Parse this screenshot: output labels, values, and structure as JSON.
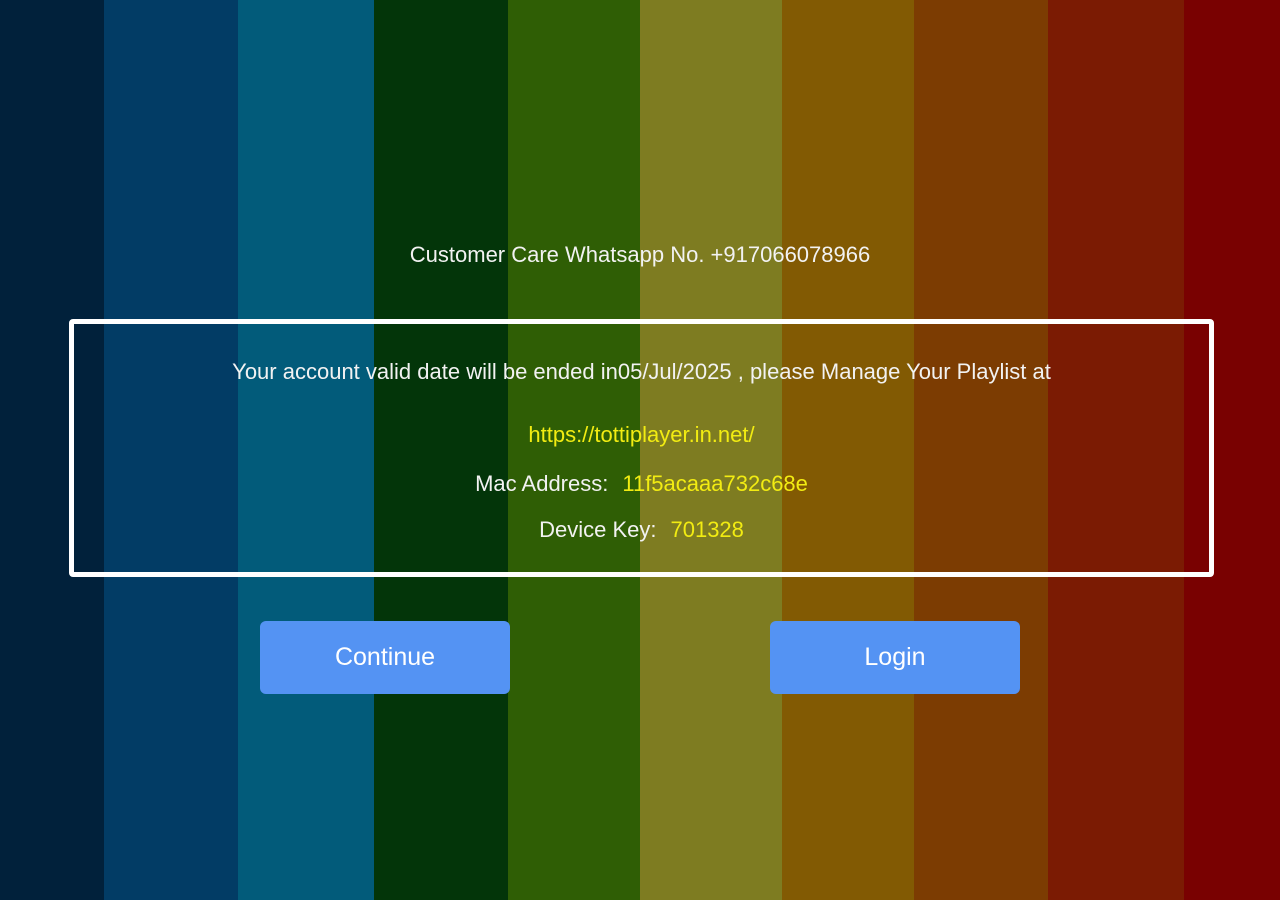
{
  "header": {
    "customer_care": "Customer Care Whatsapp No. +917066078966"
  },
  "notice": {
    "validity_message": "Your account valid date will be ended in05/Jul/2025 , please Manage Your Playlist at",
    "url": "https://tottiplayer.in.net/",
    "mac_label": "Mac Address:",
    "mac_value": "11f5acaaa732c68e",
    "device_key_label": "Device Key:",
    "device_key_value": "701328"
  },
  "buttons": {
    "continue_label": "Continue",
    "login_label": "Login"
  },
  "colors": {
    "button_bg": "#5493f3",
    "highlight_text": "#f2ec12",
    "box_border": "#ffffff"
  }
}
